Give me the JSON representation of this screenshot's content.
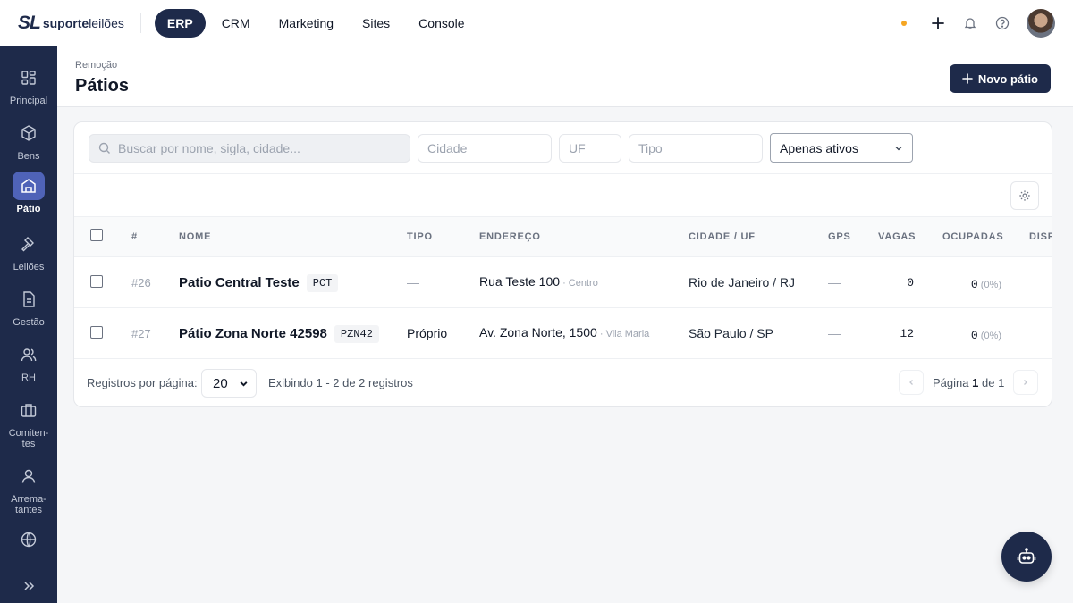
{
  "brand": {
    "logo_mark": "SL",
    "logo_text_bold": "suporte",
    "logo_text": "leilões"
  },
  "topnav": [
    {
      "label": "ERP",
      "active": true
    },
    {
      "label": "CRM"
    },
    {
      "label": "Marketing"
    },
    {
      "label": "Sites"
    },
    {
      "label": "Console"
    }
  ],
  "sidebar": {
    "items": [
      {
        "label": "Principal",
        "icon": "grid-icon"
      },
      {
        "label": "Bens",
        "icon": "box-icon"
      },
      {
        "label": "Pátio",
        "icon": "warehouse-icon",
        "active": true
      },
      {
        "label": "Leilões",
        "icon": "gavel-icon"
      },
      {
        "label": "Gestão",
        "icon": "document-icon"
      },
      {
        "label": "RH",
        "icon": "users-icon"
      },
      {
        "label": "Comiten-\ntes",
        "icon": "briefcase-icon"
      },
      {
        "label": "Arrema-\ntantes",
        "icon": "user-icon"
      },
      {
        "label": "",
        "icon": "globe-icon"
      }
    ]
  },
  "header": {
    "breadcrumb": "Remoção",
    "title": "Pátios",
    "new_button": "Novo pátio"
  },
  "filters": {
    "search_placeholder": "Buscar por nome, sigla, cidade...",
    "city_placeholder": "Cidade",
    "uf_placeholder": "UF",
    "type_placeholder": "Tipo",
    "status_value": "Apenas ativos"
  },
  "table": {
    "columns": [
      "#",
      "NOME",
      "TIPO",
      "ENDEREÇO",
      "CIDADE / UF",
      "GPS",
      "VAGAS",
      "OCUPADAS",
      "DISP"
    ],
    "rows": [
      {
        "id": "#26",
        "name": "Patio Central Teste",
        "sigla": "PCT",
        "tipo": "—",
        "address": "Rua Teste 100",
        "bairro": " · Centro",
        "city": "Rio de Janeiro / RJ",
        "gps": "—",
        "vagas": "0",
        "ocupadas": "0",
        "pct": " (0%)"
      },
      {
        "id": "#27",
        "name": "Pátio Zona Norte 42598",
        "sigla": "PZN42",
        "tipo": "Próprio",
        "address": "Av. Zona Norte, 1500",
        "bairro": " · Vila Maria",
        "city": "São Paulo / SP",
        "gps": "—",
        "vagas": "12",
        "ocupadas": "0",
        "pct": " (0%)"
      }
    ]
  },
  "footer": {
    "per_page_label": "Registros por página:",
    "per_page_value": "20",
    "showing": "Exibindo 1 - 2 de 2 registros",
    "page_prefix": "Página",
    "page_current": "1",
    "page_sep": "de",
    "page_total": "1"
  },
  "colors": {
    "navy": "#1e2a4a",
    "accent": "#4f63b8",
    "dot": "#f5a623"
  }
}
